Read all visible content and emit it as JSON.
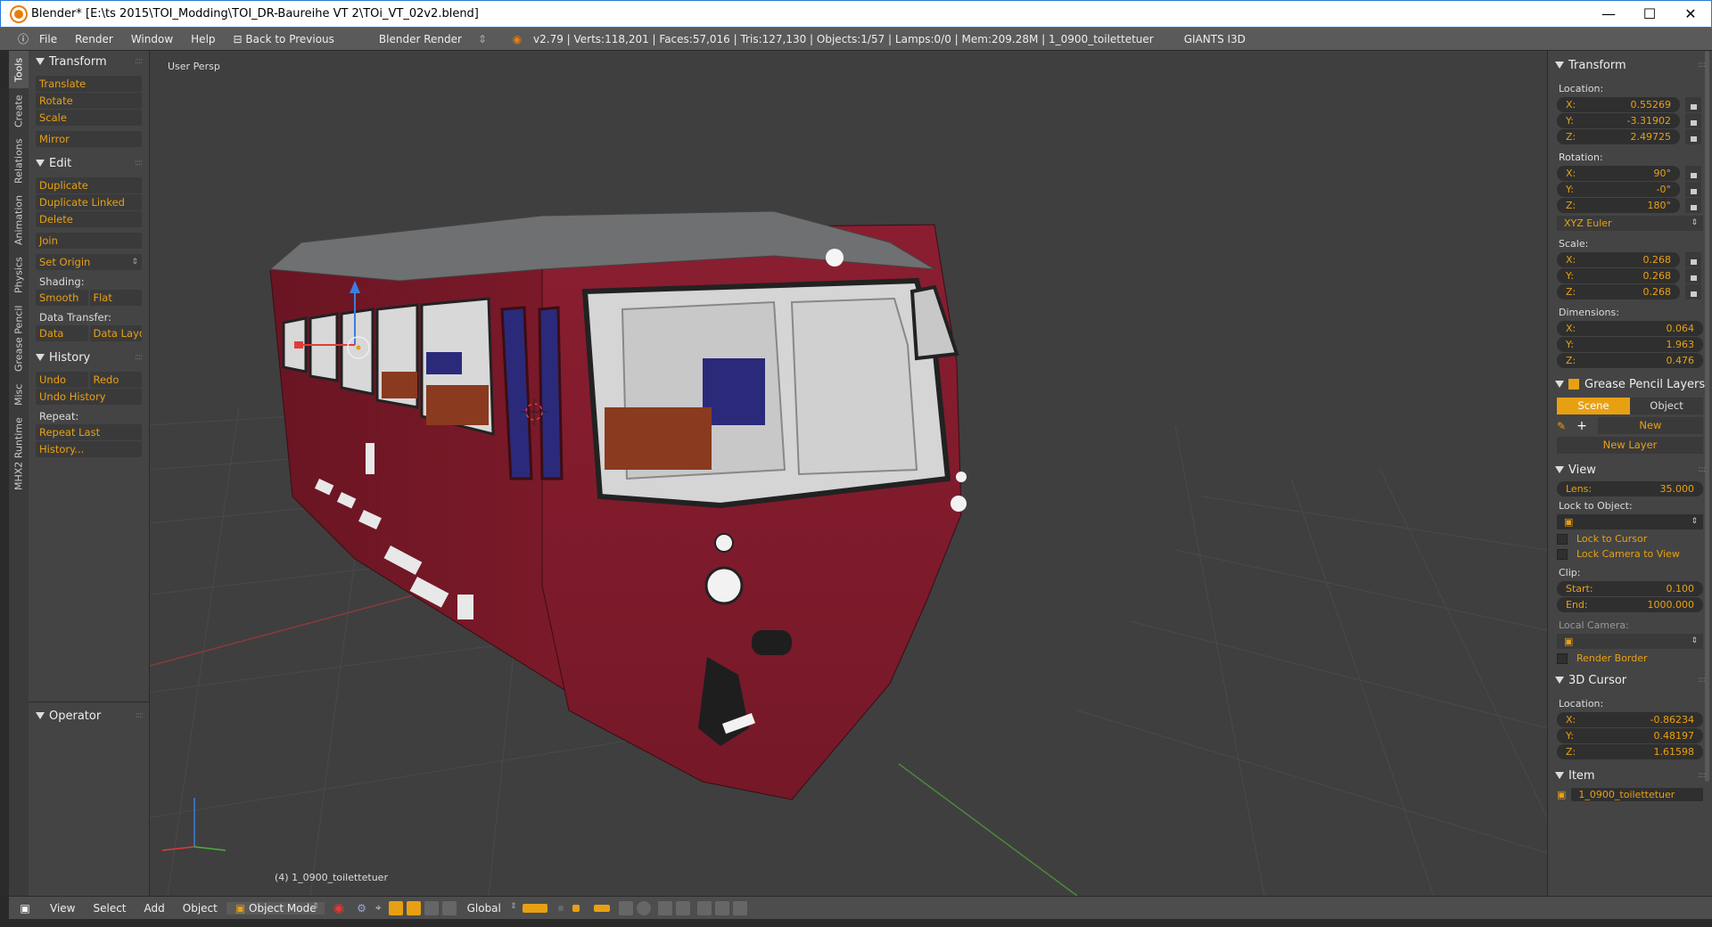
{
  "window": {
    "title": "Blender* [E:\\ts 2015\\TOI_Modding\\TOI_DR-Baureihe VT 2\\TOi_VT_02v2.blend]",
    "minimize": "—",
    "maximize": "☐",
    "close": "✕"
  },
  "infobar": {
    "menus": [
      "File",
      "Render",
      "Window",
      "Help"
    ],
    "back": "Back to Previous",
    "engine": "Blender Render",
    "stats": "v2.79 | Verts:118,201 | Faces:57,016 | Tris:127,130 | Objects:1/57 | Lamps:0/0 | Mem:209.28M | 1_0900_toilettetuer",
    "giants": "GIANTS I3D"
  },
  "left_tabs": [
    "Tools",
    "Create",
    "Relations",
    "Animation",
    "Physics",
    "Grease Pencil",
    "Misc",
    "MHX2 Runtime"
  ],
  "toolshelf": {
    "transform_header": "Transform",
    "translate": "Translate",
    "rotate": "Rotate",
    "scale": "Scale",
    "mirror": "Mirror",
    "edit_header": "Edit",
    "duplicate": "Duplicate",
    "duplicate_linked": "Duplicate Linked",
    "delete": "Delete",
    "join": "Join",
    "set_origin": "Set Origin",
    "shading_label": "Shading:",
    "smooth": "Smooth",
    "flat": "Flat",
    "data_transfer_label": "Data Transfer:",
    "data": "Data",
    "data_layo": "Data Layo",
    "history_header": "History",
    "undo": "Undo",
    "redo": "Redo",
    "undo_history": "Undo History",
    "repeat_label": "Repeat:",
    "repeat_last": "Repeat Last",
    "history": "History...",
    "operator_header": "Operator"
  },
  "viewport": {
    "label": "User Persp",
    "object_name": "(4) 1_0900_toilettetuer"
  },
  "npanel": {
    "transform_header": "Transform",
    "location_label": "Location:",
    "location": [
      {
        "axis": "X:",
        "value": "0.55269"
      },
      {
        "axis": "Y:",
        "value": "-3.31902"
      },
      {
        "axis": "Z:",
        "value": "2.49725"
      }
    ],
    "rotation_label": "Rotation:",
    "rotation": [
      {
        "axis": "X:",
        "value": "90°"
      },
      {
        "axis": "Y:",
        "value": "-0°"
      },
      {
        "axis": "Z:",
        "value": "180°"
      }
    ],
    "rotation_mode": "XYZ Euler",
    "scale_label": "Scale:",
    "scale": [
      {
        "axis": "X:",
        "value": "0.268"
      },
      {
        "axis": "Y:",
        "value": "0.268"
      },
      {
        "axis": "Z:",
        "value": "0.268"
      }
    ],
    "dimensions_label": "Dimensions:",
    "dimensions": [
      {
        "axis": "X:",
        "value": "0.064"
      },
      {
        "axis": "Y:",
        "value": "1.963"
      },
      {
        "axis": "Z:",
        "value": "0.476"
      }
    ],
    "grease_header": "Grease Pencil Layers",
    "scene": "Scene",
    "object": "Object",
    "new": "New",
    "new_layer": "New Layer",
    "view_header": "View",
    "lens_label": "Lens:",
    "lens_value": "35.000",
    "lock_to_object": "Lock to Object:",
    "lock_to_cursor": "Lock to Cursor",
    "lock_camera": "Lock Camera to View",
    "clip_label": "Clip:",
    "clip_start_label": "Start:",
    "clip_start": "0.100",
    "clip_end_label": "End:",
    "clip_end": "1000.000",
    "local_camera": "Local Camera:",
    "render_border": "Render Border",
    "cursor_header": "3D Cursor",
    "cursor_location_label": "Location:",
    "cursor": [
      {
        "axis": "X:",
        "value": "-0.86234"
      },
      {
        "axis": "Y:",
        "value": "0.48197"
      },
      {
        "axis": "Z:",
        "value": "1.61598"
      }
    ],
    "item_header": "Item",
    "item_name": "1_0900_toilettetuer"
  },
  "bottombar": {
    "menus": [
      "View",
      "Select",
      "Add",
      "Object"
    ],
    "mode": "Object Mode",
    "orientation": "Global"
  },
  "colors": {
    "accent": "#e8a013",
    "train_body": "#7d1a2a",
    "viewport_bg": "#3f3f3f"
  }
}
